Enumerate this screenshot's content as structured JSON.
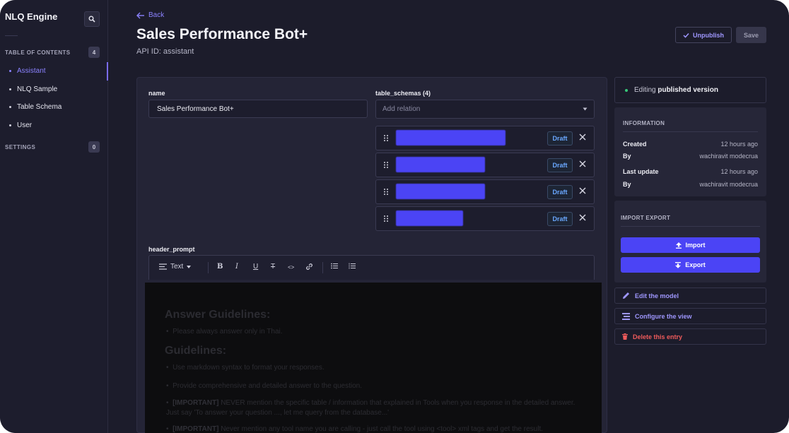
{
  "sidebar": {
    "brand": "NLQ Engine",
    "toc_title": "TABLE OF CONTENTS",
    "toc_count": "4",
    "items": [
      {
        "label": "Assistant"
      },
      {
        "label": "NLQ Sample"
      },
      {
        "label": "Table Schema"
      },
      {
        "label": "User"
      }
    ],
    "settings_title": "SETTINGS",
    "settings_count": "0"
  },
  "header": {
    "back_label": "Back",
    "title": "Sales Performance Bot+",
    "api_id": "API ID: assistant",
    "unpublish_label": "Unpublish",
    "save_label": "Save"
  },
  "form": {
    "name_label": "name",
    "name_value": "Sales Performance Bot+",
    "relations_label": "table_schemas (4)",
    "relation_placeholder": "Add relation",
    "relations": [
      {
        "status": "Draft",
        "redacted_width_fraction": 1.0
      },
      {
        "status": "Draft",
        "redacted_width_fraction": 0.81
      },
      {
        "status": "Draft",
        "redacted_width_fraction": 0.81
      },
      {
        "status": "Draft",
        "redacted_width_fraction": 0.61
      }
    ],
    "prompt_label": "header_prompt",
    "toolbar": {
      "style_label": "Text",
      "buttons": [
        "bold-icon",
        "italic-icon",
        "underline-icon",
        "strikethrough-icon",
        "code-icon",
        "link-icon",
        "bullet-list-icon",
        "numbered-list-icon"
      ]
    },
    "prompt_content": {
      "heading1": "Answer Guidelines:",
      "bullet1": "Please always answer only in Thai.",
      "heading2": "Guidelines:",
      "bullet2": "Use markdown syntax to format your responses.",
      "bullet3": "Provide comprehensive and detailed answer to the question.",
      "bullet4_strong": "[IMPORTANT]",
      "bullet4_text": " NEVER mention the specific table / information that explained in Tools when you response in the detailed answer. Just say 'To answer your question ..., let me query from the database...'",
      "bullet5_strong": "[IMPORTANT]",
      "bullet5_text": " Never mention any tool name you are calling - just call the tool using <tool> xml tags and get the result."
    }
  },
  "side": {
    "status_prefix": "Editing",
    "status_strong": "published version",
    "info_title": "INFORMATION",
    "created_label": "Created",
    "created_value": "12 hours ago",
    "by_label": "By",
    "created_by": "wachiravit modecrua",
    "updated_label": "Last update",
    "updated_value": "12 hours ago",
    "updated_by": "wachiravit modecrua",
    "ie_title": "IMPORT EXPORT",
    "import_label": "Import",
    "export_label": "Export",
    "edit_model_label": "Edit the model",
    "configure_view_label": "Configure the view",
    "delete_label": "Delete this entry"
  },
  "colors": {
    "background": "#1c1c2b",
    "panel": "#242436",
    "accent": "#4b44f5",
    "accent_text": "#8b82ff",
    "draft": "#6aa8ff",
    "danger": "#ef5b5b",
    "success": "#37c979"
  }
}
